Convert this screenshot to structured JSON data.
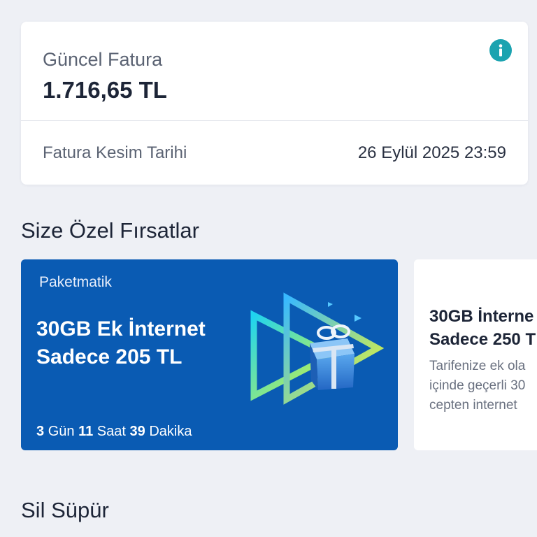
{
  "bill": {
    "label": "Güncel Fatura",
    "amount": "1.716,65 TL",
    "info_icon": "info-icon",
    "cut_label": "Fatura Kesim Tarihi",
    "cut_date": "26 Eylül 2025 23:59"
  },
  "offers_section": {
    "title": "Size Özel Fırsatlar"
  },
  "offers": [
    {
      "tag": "Paketmatik",
      "title": "30GB Ek İnternet Sadece 205 TL",
      "timer": {
        "days": "3",
        "days_unit": "Gün",
        "hours": "11",
        "hours_unit": "Saat",
        "minutes": "39",
        "minutes_unit": "Dakika"
      },
      "bg_color": "#0a5bb3",
      "art_icon": "gift-box-fast-forward-icon"
    },
    {
      "title": "30GB İnterne\nSadece 250 T",
      "description": "Tarifenize ek ola\niçinde geçerli 30\ncepten internet"
    }
  ],
  "second_section": {
    "title": "Sil Süpür"
  },
  "colors": {
    "accent": "#1ba3b0",
    "offer_blue": "#0a5bb3",
    "background": "#eef0f5"
  }
}
